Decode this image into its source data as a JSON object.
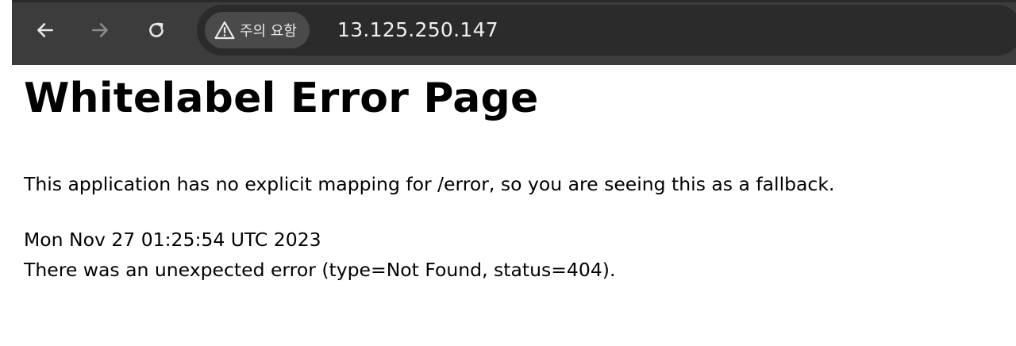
{
  "browser": {
    "back_icon": "arrow-left-icon",
    "forward_icon": "arrow-right-icon",
    "reload_icon": "reload-icon",
    "security_warning_icon": "warning-triangle-icon",
    "security_label": "주의 요함",
    "url": "13.125.250.147"
  },
  "page": {
    "title": "Whitelabel Error Page",
    "description": "This application has no explicit mapping for /error, so you are seeing this as a fallback.",
    "timestamp": "Mon Nov 27 01:25:54 UTC 2023",
    "error_detail": "There was an unexpected error (type=Not Found, status=404)."
  },
  "colors": {
    "toolbar_bg": "#3c3c3c",
    "omnibox_bg": "#2b2b2b",
    "chip_bg": "#4a4a4a",
    "page_bg": "#ffffff",
    "text": "#000000"
  }
}
